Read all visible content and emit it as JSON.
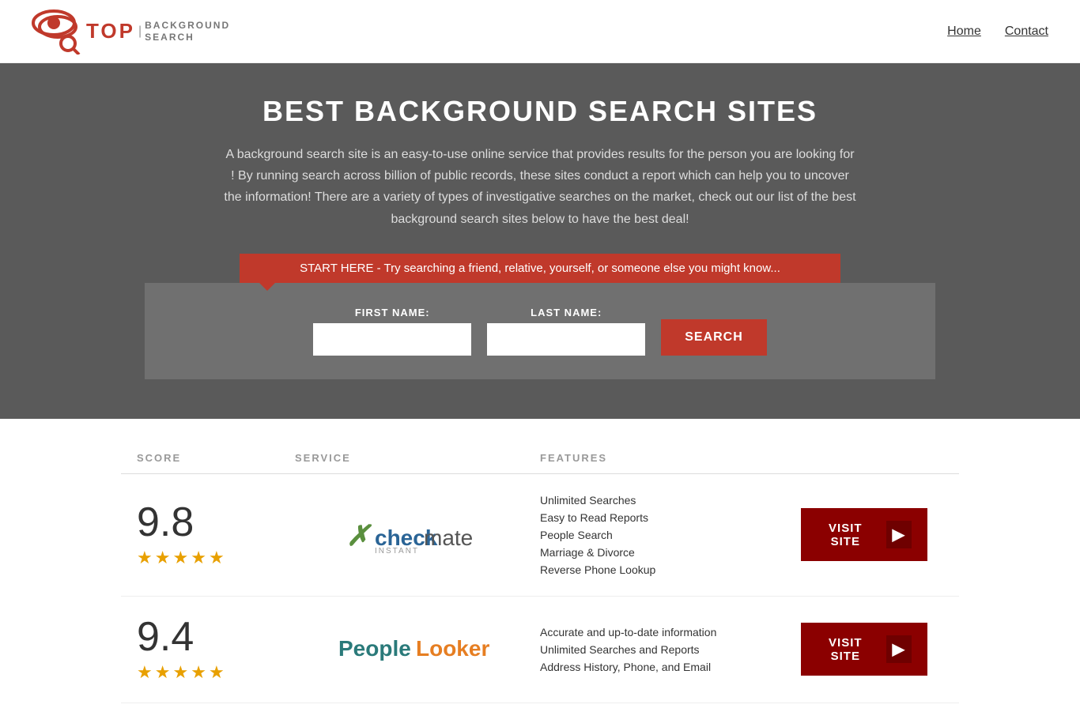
{
  "header": {
    "logo_top": "TOP",
    "logo_bg_line1": "BACKGROUND",
    "logo_bg_line2": "SEARCH",
    "nav": [
      {
        "label": "Home",
        "href": "#"
      },
      {
        "label": "Contact",
        "href": "#"
      }
    ]
  },
  "hero": {
    "title": "BEST BACKGROUND SEARCH SITES",
    "description": "A background search site is an easy-to-use online service that provides results  for the person you are looking for ! By  running  search across billion of public records, these sites conduct  a report which can help you to uncover the information! There are a variety of types of investigative searches on the market, check out our  list of the best background search sites below to have the best deal!",
    "search_banner": "START HERE - Try searching a friend, relative, yourself, or someone else you might know...",
    "form": {
      "first_name_label": "FIRST NAME:",
      "last_name_label": "LAST NAME:",
      "search_button": "SEARCH"
    }
  },
  "table": {
    "headers": {
      "score": "SCORE",
      "service": "SERVICE",
      "features": "FEATURES",
      "action": ""
    },
    "rows": [
      {
        "score": "9.8",
        "stars": 4.5,
        "service_name": "Instant Checkmate",
        "service_type": "checkmate",
        "features": [
          "Unlimited Searches",
          "Easy to Read Reports",
          "People Search",
          "Marriage & Divorce",
          "Reverse Phone Lookup"
        ],
        "visit_label": "VISIT SITE"
      },
      {
        "score": "9.4",
        "stars": 4.5,
        "service_name": "PeopleLooker",
        "service_type": "peoplelooker",
        "features": [
          "Accurate and up-to-date information",
          "Unlimited Searches and Reports",
          "Address History, Phone, and Email"
        ],
        "visit_label": "VISIT SITE"
      }
    ]
  }
}
